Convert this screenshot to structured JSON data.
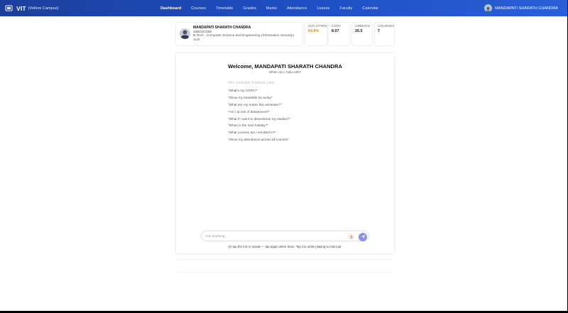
{
  "navbar": {
    "brand_name": "VIT",
    "brand_sub": "(Vellore Campus)",
    "links": [
      {
        "label": "Dashboard",
        "active": true
      },
      {
        "label": "Courses"
      },
      {
        "label": "Timetable"
      },
      {
        "label": "Grades"
      },
      {
        "label": "Marks"
      },
      {
        "label": "Attendance"
      },
      {
        "label": "Leaves"
      },
      {
        "label": "Faculty"
      },
      {
        "label": "Calendar"
      }
    ],
    "user_name": "MANDAPATI SHARATH CHANDRA"
  },
  "profile": {
    "name": "MANDAPATI SHARATH CHANDRA",
    "reg_no": "23BCE0188",
    "program": "B.Tech - Computer Science and Engineering (Information Security)",
    "campus": "VLR"
  },
  "stats": {
    "attendance_label": "AVG ATTENDANCE",
    "attendance_value": "64.8%",
    "cgpa_label": "CGPA",
    "cgpa_value": "8.07",
    "credits_label": "CREDITS",
    "credits_value": "26.5",
    "courses_label": "COURSES",
    "courses_value": "7"
  },
  "chat": {
    "welcome": "Welcome, MANDAPATI SHARATH CHANDRA",
    "subtitle": "What can I help with?",
    "try_title": "TRY ASKING THINGS LIKE",
    "suggestions": [
      "\"What's my CGPA?\"",
      "\"Show my timetable for today\"",
      "\"What are my marks this semester?\"",
      "\"Am I at risk of detainment?\"",
      "\"What if I want to discontinue my studies?\"",
      "\"When is the next holiday?\"",
      "\"What courses am I enrolled in?\"",
      "\"Show my attendance across all courses\""
    ],
    "input_placeholder": "Ask anything...",
    "hint": "Or tap the mic to speak — tap again when done. Tap mic while playing to interrupt."
  },
  "colors": {
    "nav_start": "#1c3f9c",
    "nav_end": "#2a5fd8",
    "send_button": "#8a8ff0",
    "attendance_warn": "#d98b1a"
  },
  "icons": {
    "brand": "vit-logo-icon",
    "mic": "mic-icon",
    "send": "send-icon"
  }
}
